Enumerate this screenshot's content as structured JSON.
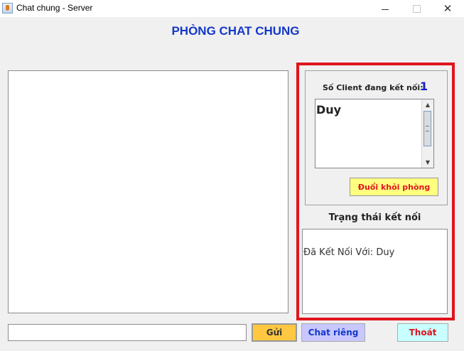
{
  "window": {
    "title": "Chat chung - Server",
    "minimize_glyph": "",
    "maximize_glyph": "",
    "close_glyph": "✕"
  },
  "room": {
    "title": "PHÒNG CHAT CHUNG"
  },
  "clients": {
    "count_label": "Số Client đang kết nối:",
    "count": "1",
    "list": [
      "Duy"
    ],
    "kick_button": "Đuổi khỏi phòng"
  },
  "status": {
    "label": "Trạng thái kết nối",
    "text": "Đã Kết Nối Với: Duy"
  },
  "composer": {
    "message_value": "",
    "send_button": "Gửi",
    "private_button": "Chat riêng",
    "exit_button": "Thoát"
  },
  "colors": {
    "title_blue": "#1438c8",
    "highlight_red": "#e0141e",
    "kick_bg": "#ffff80",
    "send_bg": "#ffc840",
    "private_bg": "#c8c8ff",
    "exit_bg": "#c8ffff"
  },
  "icons": {
    "app": "java-coffee-icon",
    "scroll_up": "arrow-up-icon",
    "scroll_down": "arrow-down-icon"
  }
}
